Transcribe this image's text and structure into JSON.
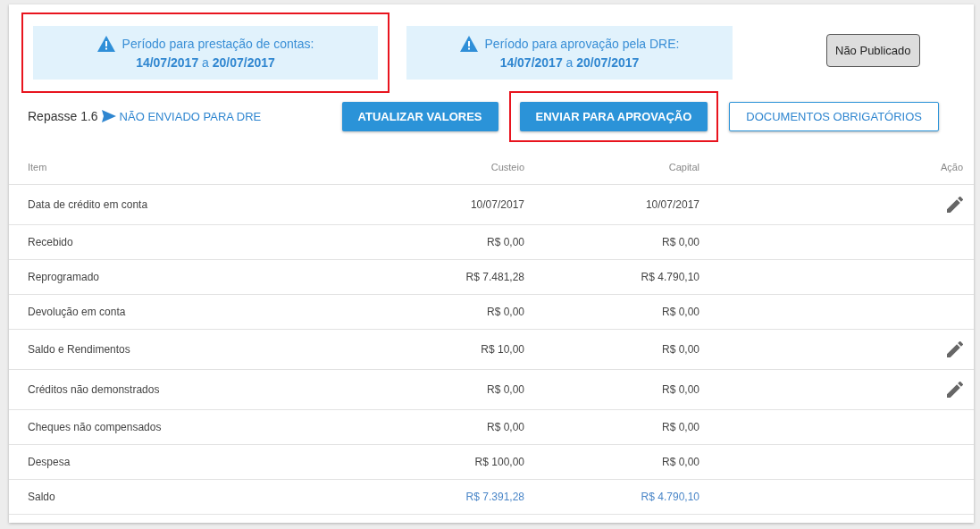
{
  "notices": [
    {
      "title": "Período para prestação de contas:",
      "period": "**14/07/2017** a **20/07/2017**",
      "highlighted": true
    },
    {
      "title": "Período para aprovação pela DRE:",
      "period": "**14/07/2017** a **20/07/2017**",
      "highlighted": false
    }
  ],
  "status_badge": "Não Publicado",
  "repasse": {
    "label": "Repasse 1.6",
    "status": "NÃO ENVIADO PARA DRE"
  },
  "buttons": [
    {
      "label": "ATUALIZAR VALORES",
      "kind": "filled",
      "highlighted": false
    },
    {
      "label": "ENVIAR PARA APROVAÇÃO",
      "kind": "filled",
      "highlighted": true
    },
    {
      "label": "DOCUMENTOS OBRIGATÓRIOS",
      "kind": "outlined",
      "highlighted": false
    }
  ],
  "table": {
    "columns": [
      "Item",
      "Custeio",
      "Capital",
      "Ação"
    ],
    "rows": [
      {
        "item": "Data de crédito em conta",
        "custeio": "10/07/2017",
        "capital": "10/07/2017",
        "editable": true,
        "total": false
      },
      {
        "item": "Recebido",
        "custeio": "R$ 0,00",
        "capital": "R$ 0,00",
        "editable": false,
        "total": false
      },
      {
        "item": "Reprogramado",
        "custeio": "R$ 7.481,28",
        "capital": "R$ 4.790,10",
        "editable": false,
        "total": false
      },
      {
        "item": "Devolução em conta",
        "custeio": "R$ 0,00",
        "capital": "R$ 0,00",
        "editable": false,
        "total": false
      },
      {
        "item": "Saldo e Rendimentos",
        "custeio": "R$ 10,00",
        "capital": "R$ 0,00",
        "editable": true,
        "total": false
      },
      {
        "item": "Créditos não demonstrados",
        "custeio": "R$ 0,00",
        "capital": "R$ 0,00",
        "editable": true,
        "total": false
      },
      {
        "item": "Cheques não compensados",
        "custeio": "R$ 0,00",
        "capital": "R$ 0,00",
        "editable": false,
        "total": false
      },
      {
        "item": "Despesa",
        "custeio": "R$ 100,00",
        "capital": "R$ 0,00",
        "editable": false,
        "total": false
      },
      {
        "item": "Saldo",
        "custeio": "R$ 7.391,28",
        "capital": "R$ 4.790,10",
        "editable": false,
        "total": true
      }
    ]
  }
}
